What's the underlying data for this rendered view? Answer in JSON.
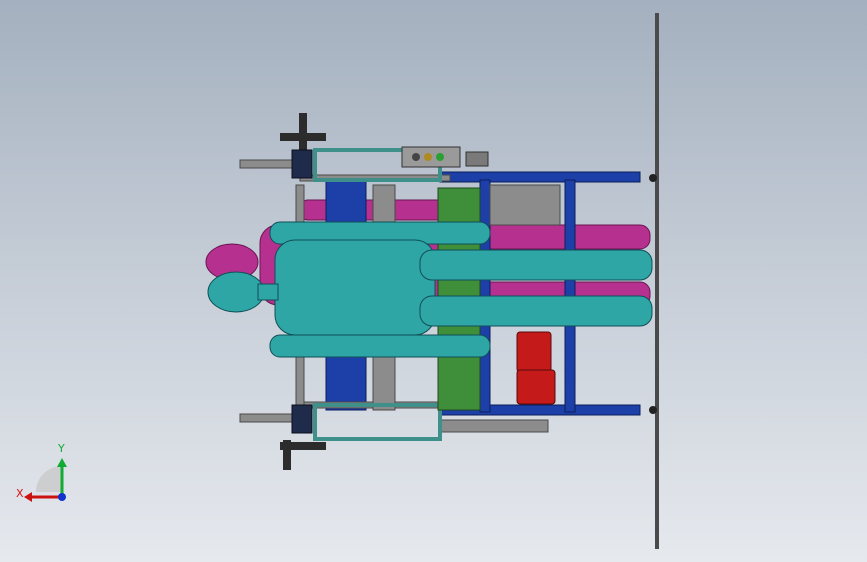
{
  "viewport": {
    "background_top": "#a4b0bf",
    "background_bottom": "#e6e9ee"
  },
  "model_colors": {
    "frame_blue": "#1d3fa8",
    "guard_teal": "#3f8f8a",
    "mannequin_teal": "#2ea6a6",
    "mannequin_magenta": "#b6308f",
    "motor_red": "#c41a1a",
    "plate_green": "#3f8f3a",
    "steel_gray": "#8c8c8c"
  },
  "triad": {
    "x_label": "X",
    "y_label": "Y",
    "x_color": "#cc1111",
    "y_color": "#11aa33",
    "z_color": "#1133cc",
    "icons": [
      "x-axis-arrow-icon",
      "y-axis-arrow-icon",
      "z-axis-dot-icon"
    ]
  }
}
